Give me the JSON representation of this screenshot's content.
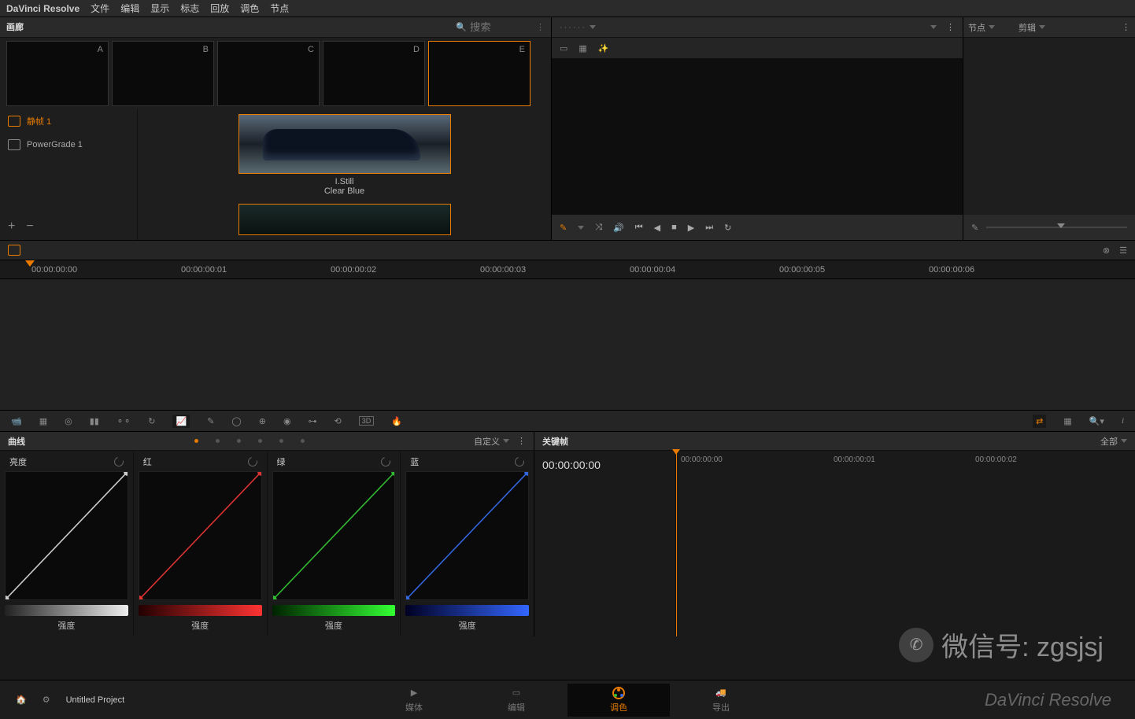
{
  "app_name": "DaVinci Resolve",
  "menu": [
    "文件",
    "编辑",
    "显示",
    "标志",
    "回放",
    "调色",
    "节点"
  ],
  "gallery": {
    "title": "画廊",
    "search_placeholder": "搜索",
    "thumbs": [
      "A",
      "B",
      "C",
      "D",
      "E"
    ],
    "selected_thumb": 4,
    "side": [
      {
        "label": "静帧 1",
        "selected": true
      },
      {
        "label": "PowerGrade 1",
        "selected": false
      }
    ],
    "still_id": "I.Still",
    "still_name": "Clear Blue"
  },
  "viewer": {
    "dots": "······"
  },
  "nodes": {
    "tab1": "节点",
    "tab2": "剪辑"
  },
  "timecodes": [
    "00:00:00:00",
    "00:00:00:01",
    "00:00:00:02",
    "00:00:00:03",
    "00:00:00:04",
    "00:00:00:05",
    "00:00:00:06"
  ],
  "curves": {
    "title": "曲线",
    "mode": "自定义",
    "ch": [
      {
        "name": "亮度",
        "color": "#ccc",
        "bar": "linear-gradient(90deg,#222,#eee)"
      },
      {
        "name": "红",
        "color": "#d33",
        "bar": "linear-gradient(90deg,#200,#f33)"
      },
      {
        "name": "绿",
        "color": "#3b3",
        "bar": "linear-gradient(90deg,#020,#3f3)"
      },
      {
        "name": "蓝",
        "color": "#36d",
        "bar": "linear-gradient(90deg,#002,#36f)"
      }
    ],
    "footer": "强度"
  },
  "keyframe": {
    "title": "关键帧",
    "mode": "全部",
    "tc": "00:00:00:00",
    "marks": [
      "00:00:00:00",
      "00:00:00:01",
      "00:00:00:02"
    ]
  },
  "bottom": {
    "project": "Untitled Project",
    "tabs": [
      {
        "label": "媒体"
      },
      {
        "label": "编辑"
      },
      {
        "label": "调色",
        "active": true
      },
      {
        "label": "导出"
      }
    ]
  },
  "watermark": "微信号: zgsjsj",
  "brand": "DaVinci Resolve"
}
